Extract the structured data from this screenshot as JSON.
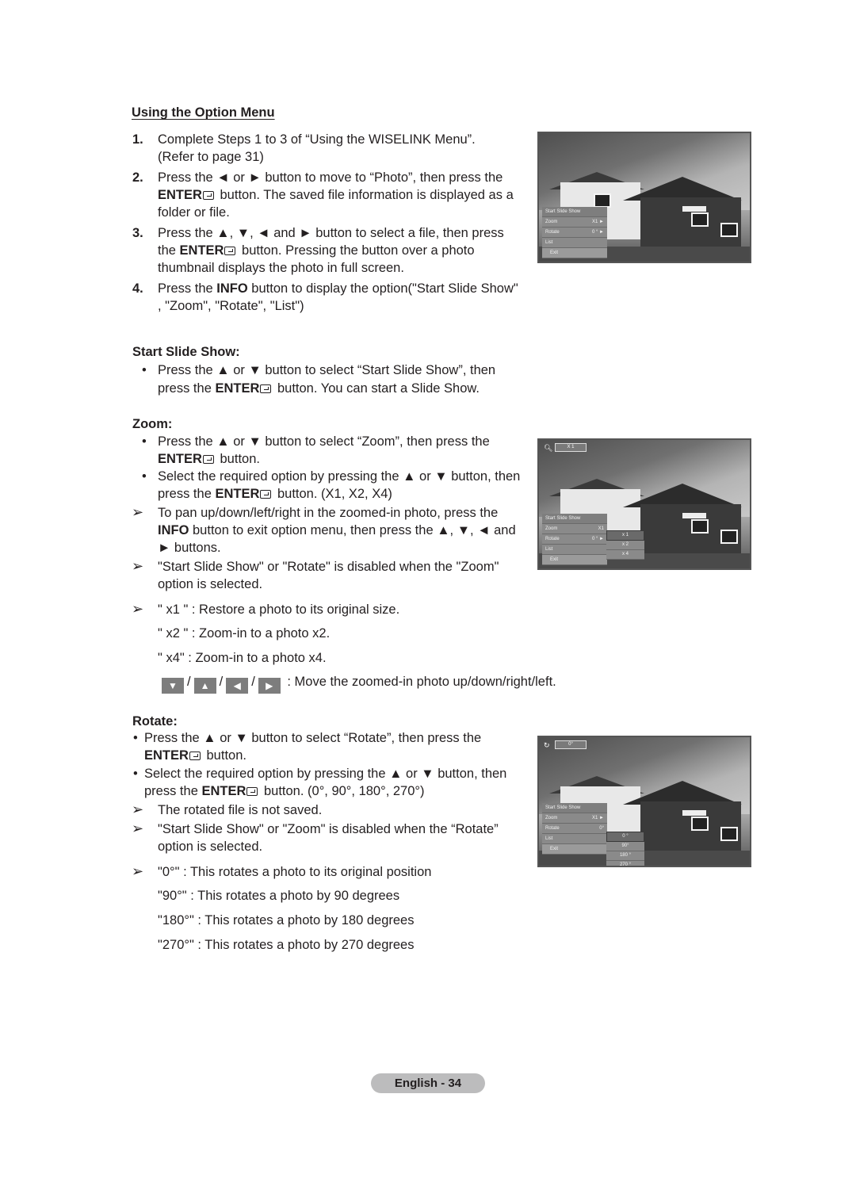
{
  "section_title": "Using the Option Menu",
  "steps": [
    {
      "num": "1.",
      "lines": [
        "Complete Steps 1 to 3 of “Using the WISELINK Menu”.",
        "(Refer to page 31)"
      ]
    },
    {
      "num": "2.",
      "lines": [
        "Press the ◄ or ► button to move to “Photo”, then press the",
        "ENTER",
        " button. The saved file information is displayed as a",
        "folder or file."
      ]
    },
    {
      "num": "3.",
      "lines": [
        "Press the ▲, ▼, ◄ and ► button to select a file, then press",
        "the ",
        "ENTER",
        " button. Pressing the button over a photo",
        "thumbnail displays the photo in full screen."
      ]
    },
    {
      "num": "4.",
      "lines": [
        "Press the ",
        "INFO",
        " button to display the option(\"Start Slide Show\"",
        ", \"Zoom\", \"Rotate\", \"List\")"
      ]
    }
  ],
  "start_slide_show": {
    "heading": "Start Slide Show:",
    "bullets": [
      {
        "l1": "Press the ▲ or ▼ button to select “Start Slide Show”, then",
        "l2a": "press the ",
        "l2b": "ENTER",
        "l2c": " button. You can start a Slide Show."
      }
    ]
  },
  "zoom": {
    "heading": "Zoom:",
    "bullet1": {
      "l1": "Press the ▲ or ▼ button to select “Zoom”, then press the",
      "l2b": "ENTER",
      "l2c": " button."
    },
    "bullet2": {
      "l1": "Select the required option by pressing the ▲ or ▼ button, then",
      "l2a": "press the ",
      "l2b": "ENTER",
      "l2c": " button. (X1, X2, X4)"
    },
    "note1": {
      "l1": "To pan up/down/left/right in the zoomed-in photo, press the",
      "l2a": "INFO",
      "l2b": " button to exit option menu, then press the ▲, ▼, ◄ and",
      "l3": "► buttons."
    },
    "note2": {
      "l1": "\"Start Slide Show\" or \"Rotate\" is disabled when the \"Zoom\"",
      "l2": "option is selected."
    },
    "levels": [
      "\" x1 \" :  Restore a photo to its original size.",
      "\" x2 \" : Zoom-in to a photo x2.",
      "\" x4\"  : Zoom-in to a photo x4."
    ],
    "nav_buttons": [
      "▼",
      "▲",
      "◀",
      "▶"
    ],
    "nav_sep": "/",
    "nav_text": ": Move the zoomed-in photo up/down/right/left."
  },
  "rotate": {
    "heading": "Rotate:",
    "bullet1": {
      "l1": "Press the ▲ or ▼ button to select “Rotate”, then press the",
      "l2b": "ENTER",
      "l2c": " button."
    },
    "bullet2": {
      "l1": "Select the required option by pressing the ▲ or ▼ button, then",
      "l2a": "press the ",
      "l2b": "ENTER",
      "l2c": " button. (0°, 90°, 180°, 270°)"
    },
    "note1": "The rotated file is not saved.",
    "note2": {
      "l1": "\"Start Slide Show\" or \"Zoom\" is disabled when the “Rotate”",
      "l2": "option is selected."
    },
    "angles": [
      "\"0°\" : This rotates a photo to its original position",
      "\"90°\" : This rotates a photo by 90 degrees",
      "\"180°\" :  This rotates a photo by 180 degrees",
      "\"270°\" : This rotates a photo by 270 degrees"
    ]
  },
  "osd_menu": {
    "start_slide_show": "Start Slide Show",
    "zoom": "Zoom",
    "zoom_value": "X1 ►",
    "zoom_value_plain": "X1",
    "rotate": "Rotate",
    "rotate_value": "0 ° ►",
    "rotate_value_plain": "0°",
    "list": "List",
    "exit": "Exit"
  },
  "zoom_screen": {
    "indicator": "X 1",
    "options": [
      "x 1",
      "x 2",
      "x 4"
    ]
  },
  "rotate_screen": {
    "indicator": "0°",
    "options": [
      "0 °",
      "90°",
      "180 °",
      "270 °"
    ]
  },
  "arrow_glyph": "➢",
  "bullet_glyph": "•",
  "footer": "English - 34"
}
